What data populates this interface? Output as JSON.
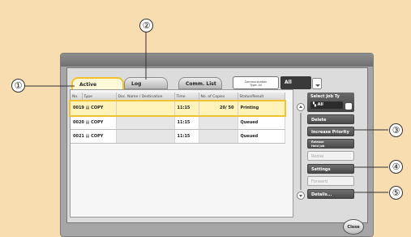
{
  "tabs": [
    {
      "label": "Active"
    },
    {
      "label": "Log"
    },
    {
      "label": "Comm. List"
    }
  ],
  "comm_list_btn": {
    "line1": "Communication",
    "line2": "Type: All"
  },
  "filter": {
    "label": "All"
  },
  "table": {
    "headers": [
      "No.",
      "Type",
      "Doc. Name / Destination",
      "Time",
      "No. of Copies",
      "Status/Result"
    ],
    "rows": [
      {
        "no": "0019",
        "type": "COPY",
        "doc": "",
        "time": "11:15",
        "copies": "20/  50",
        "status": "Printing"
      },
      {
        "no": "0020",
        "type": "COPY",
        "doc": "",
        "time": "11:15",
        "copies": "",
        "status": "Queued"
      },
      {
        "no": "0021",
        "type": "COPY",
        "doc": "",
        "time": "11:15",
        "copies": "",
        "status": "Queued"
      }
    ]
  },
  "side": {
    "select_job_label": "Select Job Ty",
    "select_job_value": "All",
    "delete": "Delete",
    "increase_priority": "Increase Priority",
    "release_held_line1": "Release",
    "release_held_line2": "Held Job",
    "redial": "Redial",
    "settings": "Settings",
    "forward": "Forward",
    "details": "Details..."
  },
  "close": "Close",
  "callouts": [
    "①",
    "②",
    "③",
    "④",
    "⑤"
  ]
}
